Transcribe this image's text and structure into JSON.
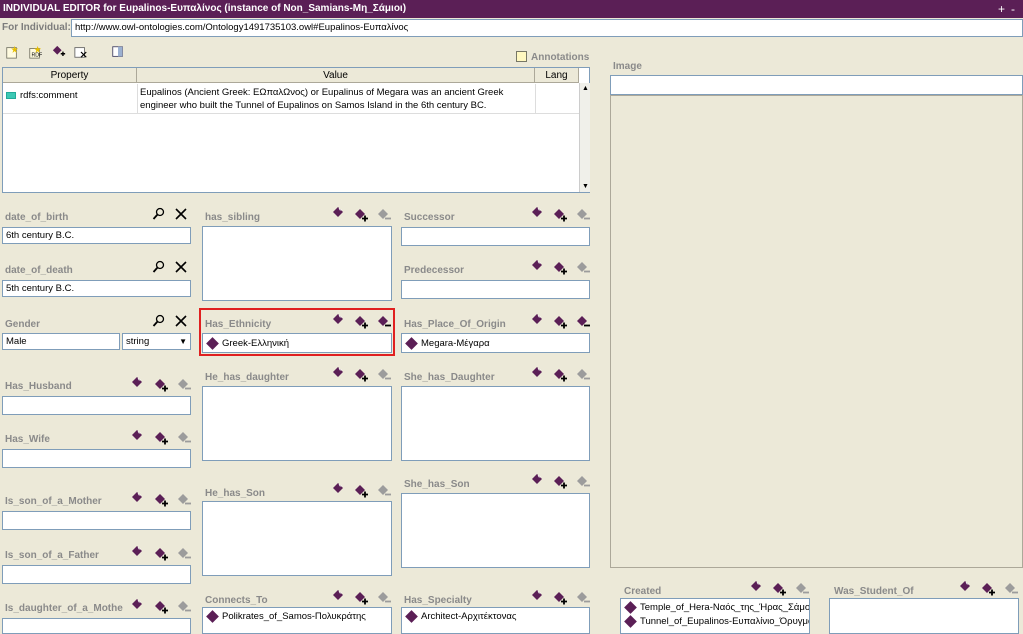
{
  "window": {
    "title": "INDIVIDUAL EDITOR for Eupalinos-Ευπαλίνος   (instance of Non_Samians-Μη_Σάμιοι)",
    "for_label": "For Individual:",
    "for_value": "http://www.owl-ontologies.com/Ontology1491735103.owl#Eupalinos-Ευπαλίνος"
  },
  "annotations": {
    "label": "Annotations",
    "headers": [
      "Property",
      "Value",
      "Lang"
    ],
    "rows": [
      {
        "property": "rdfs:comment",
        "value_line1": "Eupalinos (Ancient Greek: ΕΩπαλΩνος) or Eupalinus of Megara was an ancient Greek",
        "value_line2": "engineer who built the Tunnel of Eupalinos on Samos Island in the 6th century BC.",
        "lang": ""
      }
    ]
  },
  "image": {
    "label": "Image",
    "value": ""
  },
  "fields": {
    "date_of_birth": {
      "label": "date_of_birth",
      "value": "6th century B.C."
    },
    "date_of_death": {
      "label": "date_of_death",
      "value": "5th century B.C."
    },
    "gender": {
      "label": "Gender",
      "value": "Male",
      "type": "string"
    },
    "has_husband": {
      "label": "Has_Husband"
    },
    "has_wife": {
      "label": "Has_Wife"
    },
    "is_son_of_a_mother": {
      "label": "Is_son_of_a_Mother"
    },
    "is_son_of_a_father": {
      "label": "Is_son_of_a_Father"
    },
    "is_daughter_of_a_mother": {
      "label": "Is_daughter_of_a_Mothe"
    },
    "has_sibling": {
      "label": "has_sibling"
    },
    "has_ethnicity": {
      "label": "Has_Ethnicity",
      "items": [
        "Greek-Ελληνική"
      ]
    },
    "he_has_daughter": {
      "label": "He_has_daughter"
    },
    "he_has_son": {
      "label": "He_has_Son"
    },
    "connects_to": {
      "label": "Connects_To",
      "items": [
        "Polikrates_of_Samos-Πολυκράτης"
      ]
    },
    "successor": {
      "label": "Successor"
    },
    "predecessor": {
      "label": "Predecessor"
    },
    "has_place_of_origin": {
      "label": "Has_Place_Of_Origin",
      "items": [
        "Megara-Μέγαρα"
      ]
    },
    "she_has_daughter": {
      "label": "She_has_Daughter"
    },
    "she_has_son": {
      "label": "She_has_Son"
    },
    "has_specialty": {
      "label": "Has_Specialty",
      "items": [
        "Architect-Αρχιτέκτονας"
      ]
    },
    "created": {
      "label": "Created",
      "items": [
        "Temple_of_Hera-Ναός_της_Ήρας_Σάμου",
        "Tunnel_of_Eupalinos-Ευπαλίνιο_Όρυγμα"
      ]
    },
    "was_student_of": {
      "label": "Was_Student_Of"
    }
  },
  "colors": {
    "titlebar": "#5b1f56",
    "highlight": "#e02020",
    "diamond": "#5b1f56"
  },
  "icons": [
    "add-icon",
    "create-icon",
    "remove-icon",
    "search-icon",
    "delete-icon"
  ]
}
